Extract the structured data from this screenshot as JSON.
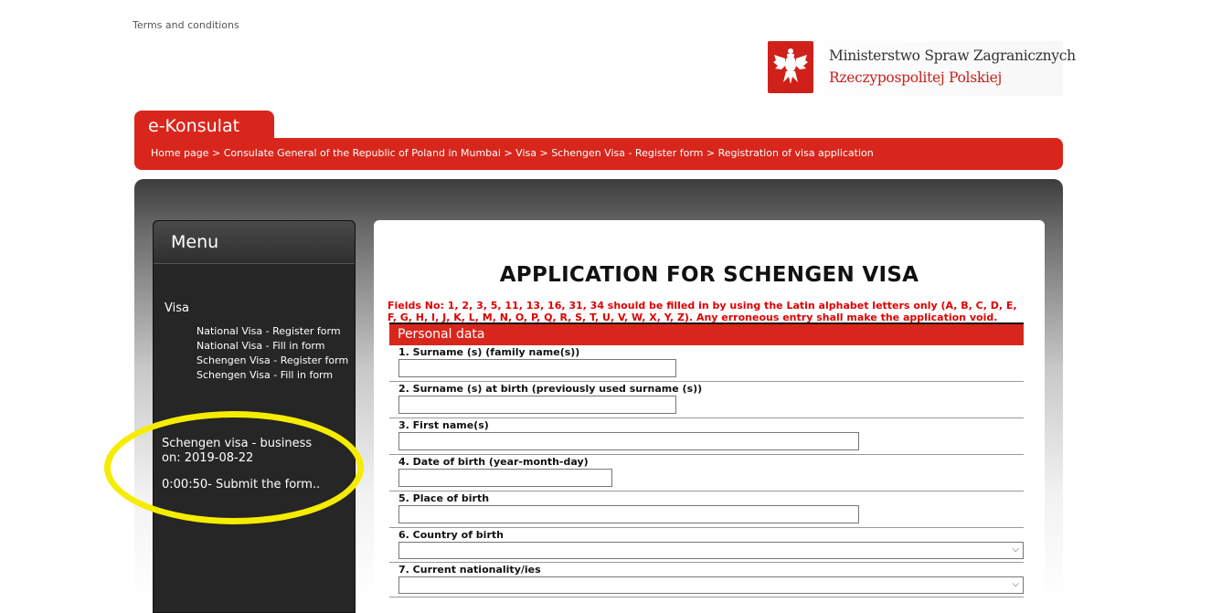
{
  "top": {
    "terms_link": "Terms and conditions",
    "ministry_line1": "Ministerstwo Spraw Zagranicznych",
    "ministry_line2": "Rzeczypospolitej Polskiej"
  },
  "header": {
    "tab_label": "e-Konsulat",
    "breadcrumb": [
      "Home page",
      "Consulate General of the Republic of Poland in Mumbai",
      "Visa",
      "Schengen Visa - Register form",
      "Registration of visa application"
    ],
    "separator": ">"
  },
  "menu": {
    "title": "Menu",
    "section": "Visa",
    "links": [
      "National Visa - Register form",
      "National Visa - Fill in form",
      "Schengen Visa - Register form",
      "Schengen Visa - Fill in form"
    ],
    "status_line1": "Schengen visa - business",
    "status_line2": "on: 2019-08-22",
    "timer": "0:00:50- Submit the form.."
  },
  "form": {
    "title": "APPLICATION FOR SCHENGEN VISA",
    "warning": "Fields No: 1, 2, 3, 5, 11, 13, 16, 31, 34 should be filled in by using the Latin alphabet letters only (A, B, C, D, E, F, G, H, I, J, K, L, M, N, O, P, Q, R, S, T, U, V, W, X, Y, Z). Any erroneous entry shall make the application void.",
    "section": "Personal data",
    "fields": [
      {
        "label": "1. Surname (s) (family name(s))",
        "value": ""
      },
      {
        "label": "2. Surname (s) at birth (previously used surname (s))",
        "value": ""
      },
      {
        "label": "3. First name(s)",
        "value": ""
      },
      {
        "label": "4. Date of birth (year-month-day)",
        "value": ""
      },
      {
        "label": "5. Place of birth",
        "value": ""
      },
      {
        "label": "6. Country of birth",
        "value": ""
      },
      {
        "label": "7. Current nationality/ies",
        "value": ""
      }
    ]
  },
  "colors": {
    "brand_red": "#d9261c",
    "warning_red": "#e00000",
    "menu_bg": "#262626",
    "highlight": "#f5ec00"
  }
}
